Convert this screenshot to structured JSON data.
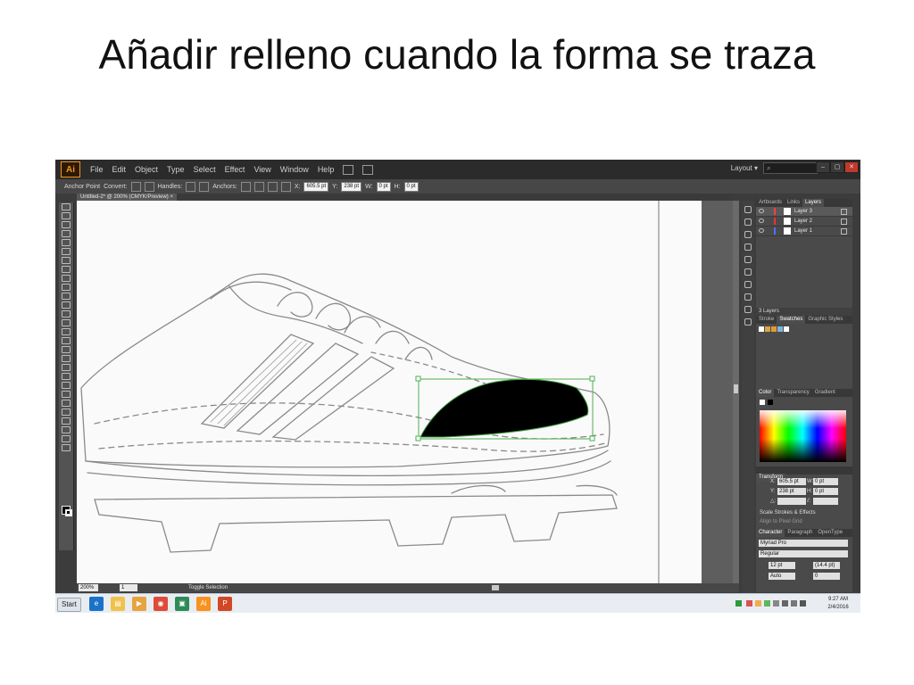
{
  "slide": {
    "title": "Añadir relleno cuando la forma se traza"
  },
  "app": {
    "logo": "Ai",
    "menus": [
      "File",
      "Edit",
      "Object",
      "Type",
      "Select",
      "Effect",
      "View",
      "Window",
      "Help"
    ],
    "workspace_label": "Layout",
    "workspace_caret": "▾",
    "search_icon": "⌕",
    "window_buttons": [
      "–",
      "▢",
      "✕"
    ]
  },
  "control_bar": {
    "anchor_point_label": "Anchor Point",
    "convert_label": "Convert:",
    "handles_label": "Handles:",
    "anchors_label": "Anchors:",
    "x_label": "X:",
    "x_value": "605.5 pt",
    "y_label": "Y:",
    "y_value": "238 pt",
    "w_label": "W:",
    "w_value": "0 pt",
    "h_label": "H:",
    "h_value": "0 pt"
  },
  "document": {
    "tab_label": "Untitled-2* @ 200% (CMYK/Preview)",
    "tab_close": "×"
  },
  "status_bar": {
    "zoom": "200%",
    "page": "1",
    "tool_status": "Toggle Selection"
  },
  "layers_panel": {
    "tabs": [
      "Artboards",
      "Links",
      "Layers"
    ],
    "active_tab": "Layers",
    "layers": [
      {
        "name": "Layer 3",
        "color": "#ff4040"
      },
      {
        "name": "Layer 2",
        "color": "#ff3030"
      },
      {
        "name": "Layer 1",
        "color": "#4f6fff"
      }
    ],
    "footer": "3 Layers"
  },
  "swatches_panel": {
    "tabs": [
      "Stroke",
      "Swatches",
      "Graphic Styles"
    ],
    "active_tab": "Swatches"
  },
  "color_panel": {
    "tabs": [
      "Color",
      "Transparency",
      "Gradient"
    ],
    "active_tab": "Color"
  },
  "transform_panel": {
    "title": "Transform",
    "x_label": "X:",
    "x_value": "605.5 pt",
    "y_label": "Y:",
    "y_value": "238 pt",
    "w_label": "W:",
    "w_value": "0 pt",
    "h_label": "H:",
    "h_value": "0 pt",
    "angle_label": "△:",
    "shear_label": "⫽:",
    "scale_strokes": "Scale Strokes & Effects",
    "align_pixel": "Align to Pixel Grid"
  },
  "character_panel": {
    "tabs": [
      "Character",
      "Paragraph",
      "OpenType"
    ],
    "active_tab": "Character",
    "font_family": "Myriad Pro",
    "font_style": "Regular",
    "font_size": "12 pt",
    "leading": "(14.4 pt)",
    "kerning": "Auto",
    "tracking": "0"
  },
  "taskbar": {
    "start_label": "Start",
    "apps": [
      "Internet Explorer",
      "Windows Explorer",
      "Media Player",
      "Chrome",
      "Desktop",
      "Illustrator",
      "PowerPoint"
    ],
    "app_colors": [
      "#1a73c8",
      "#f0c24b",
      "#e7a340",
      "#dd4b39",
      "#2e8b57",
      "#f7931e",
      "#d24726"
    ],
    "app_glyphs": [
      "e",
      "▤",
      "▶",
      "◉",
      "▣",
      "Ai",
      "P"
    ],
    "time": "9:27 AM",
    "date": "2/4/2016"
  }
}
